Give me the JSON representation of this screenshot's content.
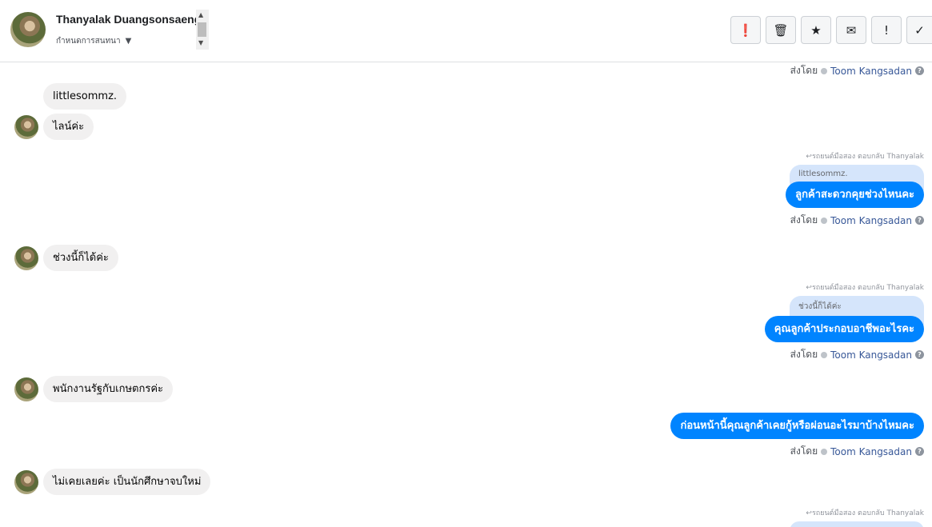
{
  "header": {
    "contact_name": "Thanyalak Duangsonsaeng",
    "convo_label": "กำหนดการสนทนา",
    "toolbar": [
      {
        "name": "report-icon",
        "glyph": "❗"
      },
      {
        "name": "trash-icon",
        "glyph": "🗑"
      },
      {
        "name": "star-icon",
        "glyph": "★"
      },
      {
        "name": "mail-icon",
        "glyph": "✉"
      },
      {
        "name": "exclamation-icon",
        "glyph": "!"
      },
      {
        "name": "checkmark-icon",
        "glyph": "✓"
      }
    ]
  },
  "thread": {
    "top_sent_by": {
      "prefix": "ส่งโดย",
      "agent": "Toom Kangsadan"
    },
    "incoming_1a": "littlesommz.",
    "incoming_1b": "ไลน์ค่ะ",
    "outgoing_1": {
      "reply_note": "รถยนต์มือสอง ตอบกลับ Thanyalak",
      "quote": "littlesommz.",
      "text": "ลูกค้าสะดวกคุยช่วงไหนคะ",
      "sent_prefix": "ส่งโดย",
      "agent": "Toom Kangsadan"
    },
    "incoming_2": "ช่วงนี้ก็ได้ค่ะ",
    "outgoing_2": {
      "reply_note": "รถยนต์มือสอง ตอบกลับ Thanyalak",
      "quote": "ช่วงนี้ก็ได้ค่ะ",
      "text": "คุณลูกค้าประกอบอาชีพอะไรคะ",
      "sent_prefix": "ส่งโดย",
      "agent": "Toom Kangsadan"
    },
    "incoming_3": "พนักงานรัฐกับเกษตกรค่ะ",
    "outgoing_3": {
      "text": "ก่อนหน้านี้คุณลูกค้าเคยกู้หรือผ่อนอะไรมาบ้างไหมคะ",
      "sent_prefix": "ส่งโดย",
      "agent": "Toom Kangsadan"
    },
    "incoming_4": "ไม่เคยเลยค่ะ เป็นนักศึกษาจบใหม่",
    "outgoing_4": {
      "reply_note": "รถยนต์มือสอง ตอบกลับ Thanyalak"
    }
  },
  "colors": {
    "outgoing_bubble": "#0084ff",
    "incoming_bubble": "#f1f0f0",
    "quote_bubble": "#d5e5fb",
    "agent_link": "#385898"
  }
}
